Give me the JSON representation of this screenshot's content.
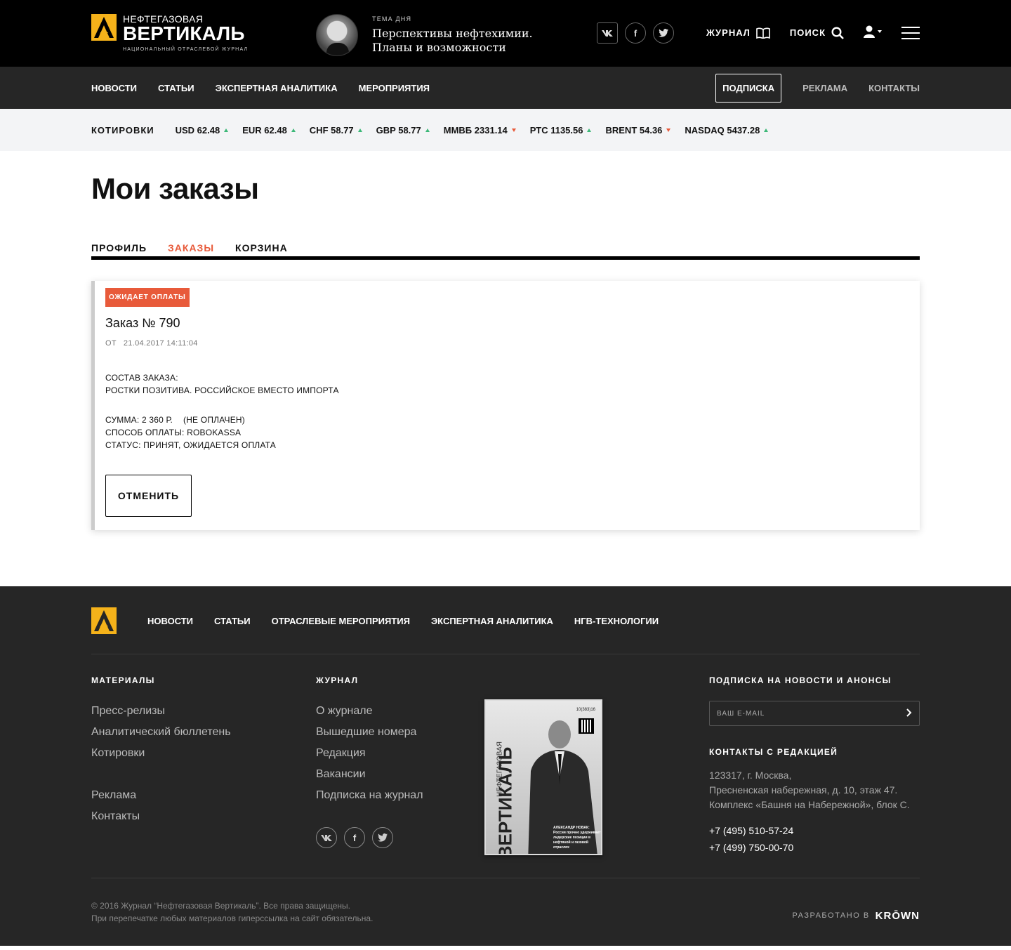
{
  "header": {
    "logo_line1": "НЕФТЕГАЗОВАЯ",
    "logo_line2": "ВЕРТИКАЛЬ",
    "logo_line3": "НАЦИОНАЛЬНЫЙ ОТРАСЛЕВОЙ ЖУРНАЛ",
    "theme_label": "ТЕМА ДНЯ",
    "theme_title": "Перспективы нефтехимии. Планы и возможности",
    "journal_label": "ЖУРНАЛ",
    "search_label": "ПОИСК"
  },
  "nav": {
    "items": [
      "НОВОСТИ",
      "СТАТЬИ",
      "ЭКСПЕРТНАЯ АНАЛИТИКА",
      "МЕРОПРИЯТИЯ"
    ],
    "subscribe": "ПОДПИСКА",
    "ads": "РЕКЛАМА",
    "contacts": "КОНТАКТЫ"
  },
  "quotes": {
    "label": "КОТИРОВКИ",
    "items": [
      {
        "text": "USD 62.48",
        "dir": "up"
      },
      {
        "text": "EUR 62.48",
        "dir": "up"
      },
      {
        "text": "CHF 58.77",
        "dir": "up"
      },
      {
        "text": "GBP 58.77",
        "dir": "up"
      },
      {
        "text": "ММВБ 2331.14",
        "dir": "down"
      },
      {
        "text": "РТС 1135.56",
        "dir": "up"
      },
      {
        "text": "BRENT 54.36",
        "dir": "down"
      },
      {
        "text": "NASDAQ 5437.28",
        "dir": "up"
      }
    ],
    "colors": {
      "up": "#3cb878",
      "down": "#e85a3a"
    }
  },
  "page": {
    "title": "Мои заказы",
    "tabs": [
      "ПРОФИЛЬ",
      "ЗАКАЗЫ",
      "КОРЗИНА"
    ],
    "active_tab": "ЗАКАЗЫ"
  },
  "order": {
    "badge": "ОЖИДАЕТ ОПЛАТЫ",
    "title": "Заказ № 790",
    "date_prefix": "ОТ",
    "date": "21.04.2017 14:11:04",
    "composition_label": "СОСТАВ ЗАКАЗА:",
    "composition_item": "РОСТКИ ПОЗИТИВА. РОССИЙСКОЕ ВМЕСТО ИМПОРТА",
    "sum": "СУММА: 2 360 Р.",
    "sum_status": "(НЕ ОПЛАЧЕН)",
    "payment": "СПОСОБ ОПЛАТЫ: ROBOKASSA",
    "status": "СТАТУС: ПРИНЯТ, ОЖИДАЕТСЯ ОПЛАТА",
    "cancel_label": "ОТМЕНИТЬ",
    "accent": "#e85a3a"
  },
  "footer": {
    "nav": [
      "НОВОСТИ",
      "СТАТЬИ",
      "ОТРАСЛЕВЫЕ МЕРОПРИЯТИЯ",
      "ЭКСПЕРТНАЯ АНАЛИТИКА",
      "НГВ-ТЕХНОЛОГИИ"
    ],
    "materials_head": "МАТЕРИАЛЫ",
    "materials": [
      "Пресс-релизы",
      "Аналитический бюллетень",
      "Котировки"
    ],
    "materials2": [
      "Реклама",
      "Контакты"
    ],
    "journal_head": "ЖУРНАЛ",
    "journal": [
      "О журнале",
      "Вышедшие номера",
      "Редакция",
      "Вакансии",
      "Подписка на журнал"
    ],
    "cover_title": "ВЕРТИКАЛЬ",
    "cover_small": "НЕФТЕГАЗОВАЯ",
    "cover_issue": "10(383)16",
    "cover_caption": "АЛЕКСАНДР НОВАК: Россия прочно удерживает лидерские позиции в нефтяной и газовой отраслях",
    "subscribe_head": "ПОДПИСКА НА НОВОСТИ И АНОНСЫ",
    "email_placeholder": "ВАШ E-MAIL",
    "contacts_head": "КОНТАКТЫ С РЕДАКЦИЕЙ",
    "address": [
      "123317, г. Москва,",
      "Пресненская набережная, д. 10, этаж 47.",
      "Комплекс «Башня на Набережной», блок С."
    ],
    "phones": [
      "+7 (495) 510-57-24",
      "+7 (499) 750-00-70"
    ],
    "copyright": "© 2016 Журнал “Нефтегазовая Вертикаль”. Все права защищены.",
    "copyright2": "При перепечатке любых материалов гиперссылка на сайт обязательна.",
    "dev_label": "РАЗРАБОТАНО В",
    "dev_name": "KRŌWN"
  },
  "brand_colors": {
    "logo_yellow": "#f5b21a",
    "dark": "#262626",
    "black": "#000000"
  }
}
